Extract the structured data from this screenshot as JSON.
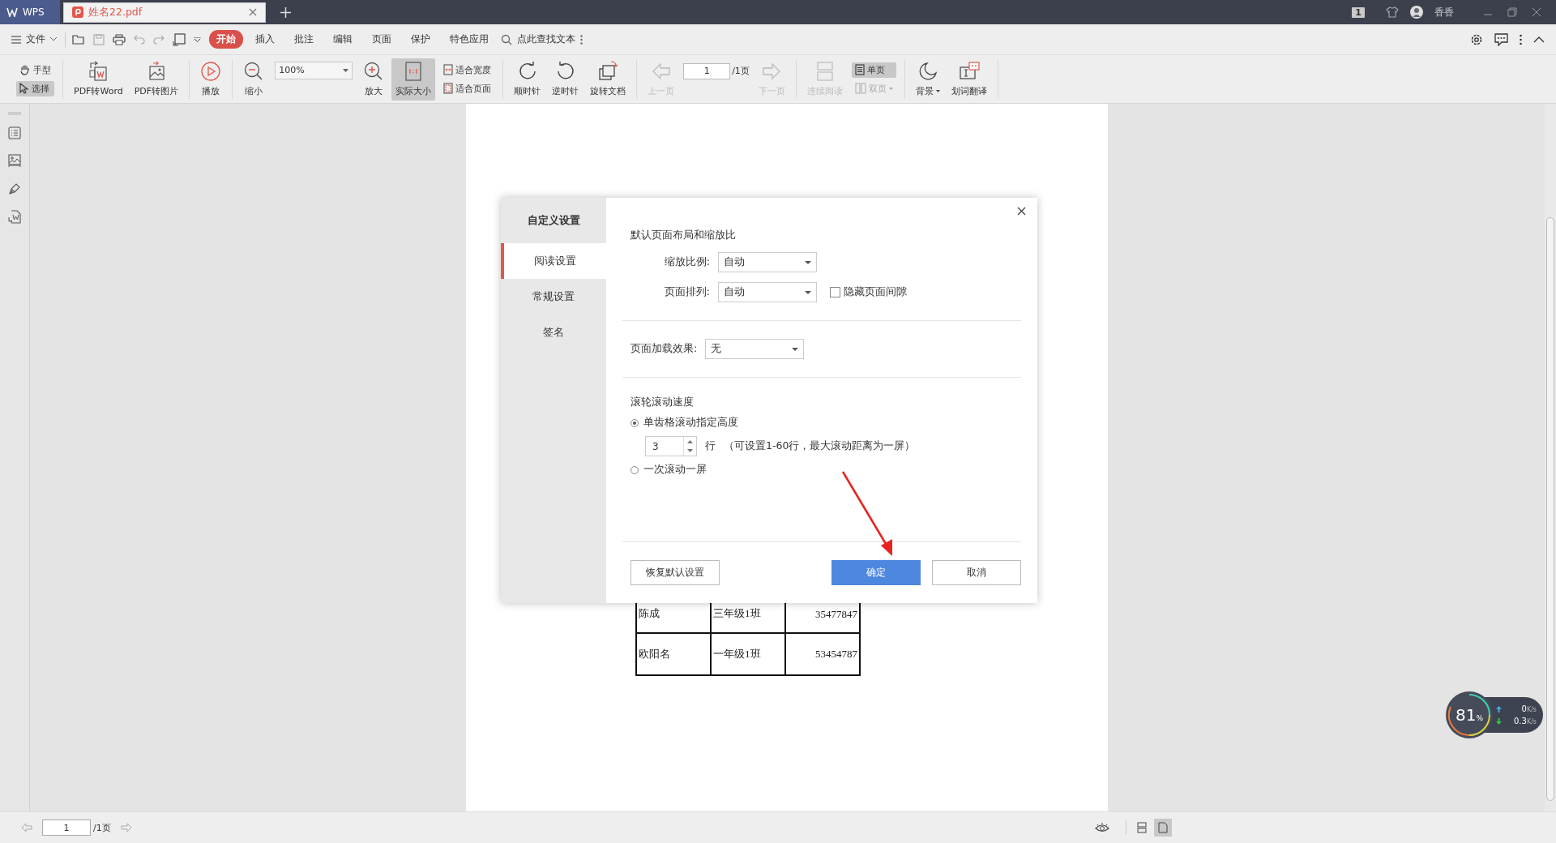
{
  "tabs": [
    {
      "label": "WPS",
      "kind": "home",
      "selected": false
    },
    {
      "label": "姓名22.pdf",
      "kind": "file",
      "selected": true
    }
  ],
  "titlebar": {
    "badge": "1",
    "user": "香香"
  },
  "menu": {
    "file": "文件",
    "tabs": [
      {
        "label": "开始",
        "selected": true
      },
      {
        "label": "插入",
        "selected": false
      },
      {
        "label": "批注",
        "selected": false
      },
      {
        "label": "编辑",
        "selected": false
      },
      {
        "label": "页面",
        "selected": false
      },
      {
        "label": "保护",
        "selected": false
      },
      {
        "label": "特色应用",
        "selected": false
      }
    ],
    "search": "点此查找文本"
  },
  "toolbar": {
    "hand": {
      "label": "手型",
      "selected": false
    },
    "select": {
      "label": "选择",
      "selected": true
    },
    "to_word": "PDF转Word",
    "to_image": "PDF转图片",
    "play": "播放",
    "zoom_out": "缩小",
    "zoom": "100%",
    "zoom_in": "放大",
    "actual": {
      "label": "实际大小",
      "selected": true
    },
    "fit_width": "适合宽度",
    "fit_page": "适合页面",
    "clockwise": "顺时针",
    "counter": "逆时针",
    "rotate": "旋转文档",
    "prev": {
      "label": "上一页",
      "disabled": true
    },
    "page": "1",
    "page_total": "/1页",
    "next": {
      "label": "下一页",
      "disabled": true
    },
    "continuous": {
      "label": "连续阅读",
      "disabled": true
    },
    "single": {
      "label": "单页",
      "selected": true,
      "disabled": false
    },
    "double": {
      "label": "双页",
      "selected": false,
      "disabled": true
    },
    "background": "背景",
    "translate": "划词翻译"
  },
  "table": {
    "rows": [
      [
        "陈成",
        "三年级1班",
        "35477847"
      ],
      [
        "欧阳名",
        "一年级1班",
        "53454787"
      ]
    ]
  },
  "dialog": {
    "nav_title": "自定义设置",
    "nav": [
      {
        "label": "阅读设置",
        "selected": true
      },
      {
        "label": "常规设置",
        "selected": false
      },
      {
        "label": "签名",
        "selected": false
      }
    ],
    "section1": "默认页面布局和缩放比",
    "zoom_label": "缩放比例:",
    "zoom_value": "自动",
    "arrange_label": "页面排列:",
    "arrange_value": "自动",
    "hide_gap": {
      "label": "隐藏页面间隙",
      "checked": false
    },
    "effect_label": "页面加载效果:",
    "effect_value": "无",
    "section2": "滚轮滚动速度",
    "radios": [
      {
        "label": "单齿格滚动指定高度",
        "selected": true
      },
      {
        "label": "一次滚动一屏",
        "selected": false
      }
    ],
    "lines": "3",
    "lines_unit": "行",
    "lines_hint": "（可设置1-60行，最大滚动距离为一屏）",
    "restore": "恢复默认设置",
    "ok": "确定",
    "cancel": "取消"
  },
  "statusbar": {
    "page": "1",
    "page_total": "/1页",
    "layouts": [
      {
        "selected": false
      },
      {
        "selected": true
      }
    ]
  },
  "speed": {
    "percent": "81",
    "unit": "%",
    "up": "0",
    "up_unit": "K/s",
    "down": "0.3",
    "down_unit": "K/s"
  }
}
